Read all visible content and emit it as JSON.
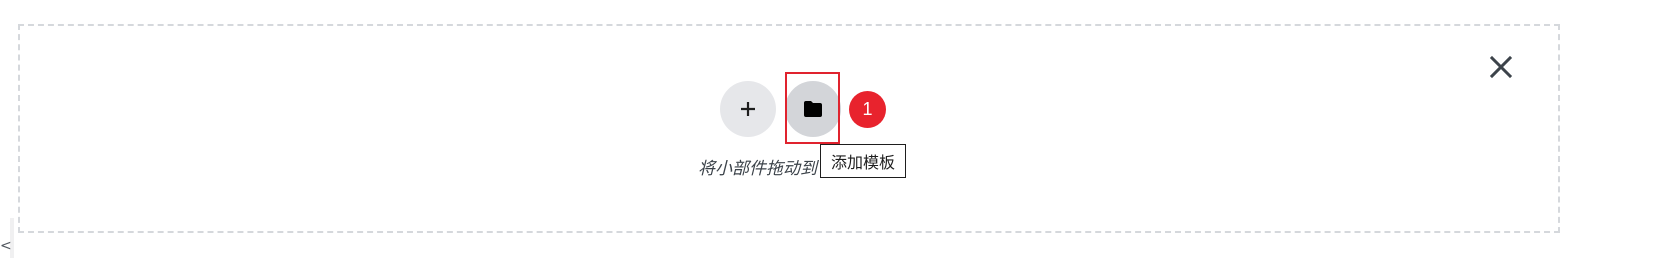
{
  "dropzone": {
    "hint_text": "将小部件拖动到",
    "add_widget_icon": "plus-icon",
    "add_template_icon": "folder-icon",
    "close_icon": "close-icon"
  },
  "tooltip": {
    "label": "添加模板"
  },
  "annotation": {
    "step_number": "1",
    "highlight_color": "#e0232e",
    "badge_color": "#e8232d"
  },
  "edge": {
    "fragment": "<"
  }
}
